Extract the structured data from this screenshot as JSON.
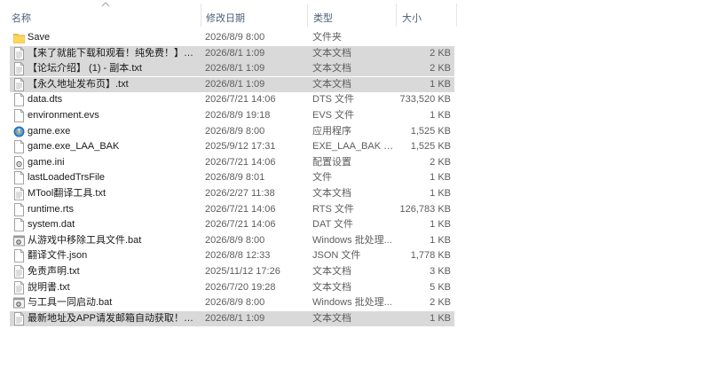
{
  "columns": {
    "name": "名称",
    "date": "修改日期",
    "type": "类型",
    "size": "大小"
  },
  "files": [
    {
      "name": "Save",
      "date": "2026/8/9 8:00",
      "type": "文件夹",
      "size": "",
      "icon": "folder-icon",
      "selected": false
    },
    {
      "name": "【来了就能下载和观看！纯免费！】- 副...",
      "date": "2026/8/1 1:09",
      "type": "文本文档",
      "size": "2 KB",
      "icon": "text-file-icon",
      "selected": true
    },
    {
      "name": "【论坛介绍】 (1) - 副本.txt",
      "date": "2026/8/1 1:09",
      "type": "文本文档",
      "size": "2 KB",
      "icon": "text-file-icon",
      "selected": true
    },
    {
      "name": "【永久地址发布页】.txt",
      "date": "2026/8/1 1:09",
      "type": "文本文档",
      "size": "1 KB",
      "icon": "text-file-icon",
      "selected": true
    },
    {
      "name": "data.dts",
      "date": "2026/7/21 14:06",
      "type": "DTS 文件",
      "size": "733,520 KB",
      "icon": "generic-file-icon",
      "selected": false
    },
    {
      "name": "environment.evs",
      "date": "2026/8/9 19:18",
      "type": "EVS 文件",
      "size": "1 KB",
      "icon": "generic-file-icon",
      "selected": false
    },
    {
      "name": "game.exe",
      "date": "2026/8/9 8:00",
      "type": "应用程序",
      "size": "1,525 KB",
      "icon": "game-app-icon",
      "selected": false
    },
    {
      "name": "game.exe_LAA_BAK",
      "date": "2025/9/12 17:31",
      "type": "EXE_LAA_BAK 文件",
      "size": "1,525 KB",
      "icon": "generic-file-icon",
      "selected": false
    },
    {
      "name": "game.ini",
      "date": "2026/7/21 14:06",
      "type": "配置设置",
      "size": "2 KB",
      "icon": "settings-file-icon",
      "selected": false
    },
    {
      "name": "lastLoadedTrsFile",
      "date": "2026/8/9 8:01",
      "type": "文件",
      "size": "1 KB",
      "icon": "generic-file-icon",
      "selected": false
    },
    {
      "name": "MTool翻译工具.txt",
      "date": "2026/2/27 11:38",
      "type": "文本文档",
      "size": "1 KB",
      "icon": "text-file-icon",
      "selected": false
    },
    {
      "name": "runtime.rts",
      "date": "2026/7/21 14:06",
      "type": "RTS 文件",
      "size": "126,783 KB",
      "icon": "generic-file-icon",
      "selected": false
    },
    {
      "name": "system.dat",
      "date": "2026/7/21 14:06",
      "type": "DAT 文件",
      "size": "1 KB",
      "icon": "generic-file-icon",
      "selected": false
    },
    {
      "name": "从游戏中移除工具文件.bat",
      "date": "2026/8/9 8:00",
      "type": "Windows 批处理...",
      "size": "1 KB",
      "icon": "batch-file-icon",
      "selected": false
    },
    {
      "name": "翻译文件.json",
      "date": "2026/8/8 12:33",
      "type": "JSON 文件",
      "size": "1,778 KB",
      "icon": "generic-file-icon",
      "selected": false
    },
    {
      "name": "免责声明.txt",
      "date": "2025/11/12 17:26",
      "type": "文本文档",
      "size": "3 KB",
      "icon": "text-file-icon",
      "selected": false
    },
    {
      "name": "說明書.txt",
      "date": "2026/7/20 19:28",
      "type": "文本文档",
      "size": "5 KB",
      "icon": "text-file-icon",
      "selected": false
    },
    {
      "name": "与工具一同启动.bat",
      "date": "2026/8/9 8:00",
      "type": "Windows 批处理...",
      "size": "2 KB",
      "icon": "batch-file-icon",
      "selected": false
    },
    {
      "name": "最新地址及APP请发邮箱自动获取！！！...",
      "date": "2026/8/1 1:09",
      "type": "文本文档",
      "size": "1 KB",
      "icon": "text-file-icon",
      "selected": true
    }
  ]
}
